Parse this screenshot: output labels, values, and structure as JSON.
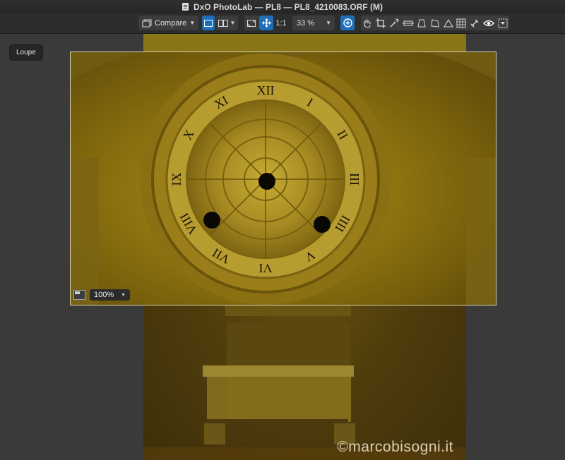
{
  "window": {
    "title": "DxO PhotoLab — PL8 — PL8_4210083.ORF (M)"
  },
  "toolbar": {
    "compare_label": "Compare",
    "one_to_one_label": "1:1",
    "zoom_value": "33 %"
  },
  "loupe": {
    "badge_label": "Loupe",
    "zoom_value": "100%"
  },
  "photo": {
    "watermark": "©marcobisogni.it"
  },
  "colors": {
    "accent": "#1f6fb8",
    "gold": "#a88d1c"
  },
  "roman_numerals": [
    "XII",
    "I",
    "II",
    "III",
    "IIII",
    "V",
    "VI",
    "VII",
    "VIII",
    "IX",
    "X",
    "XI"
  ]
}
